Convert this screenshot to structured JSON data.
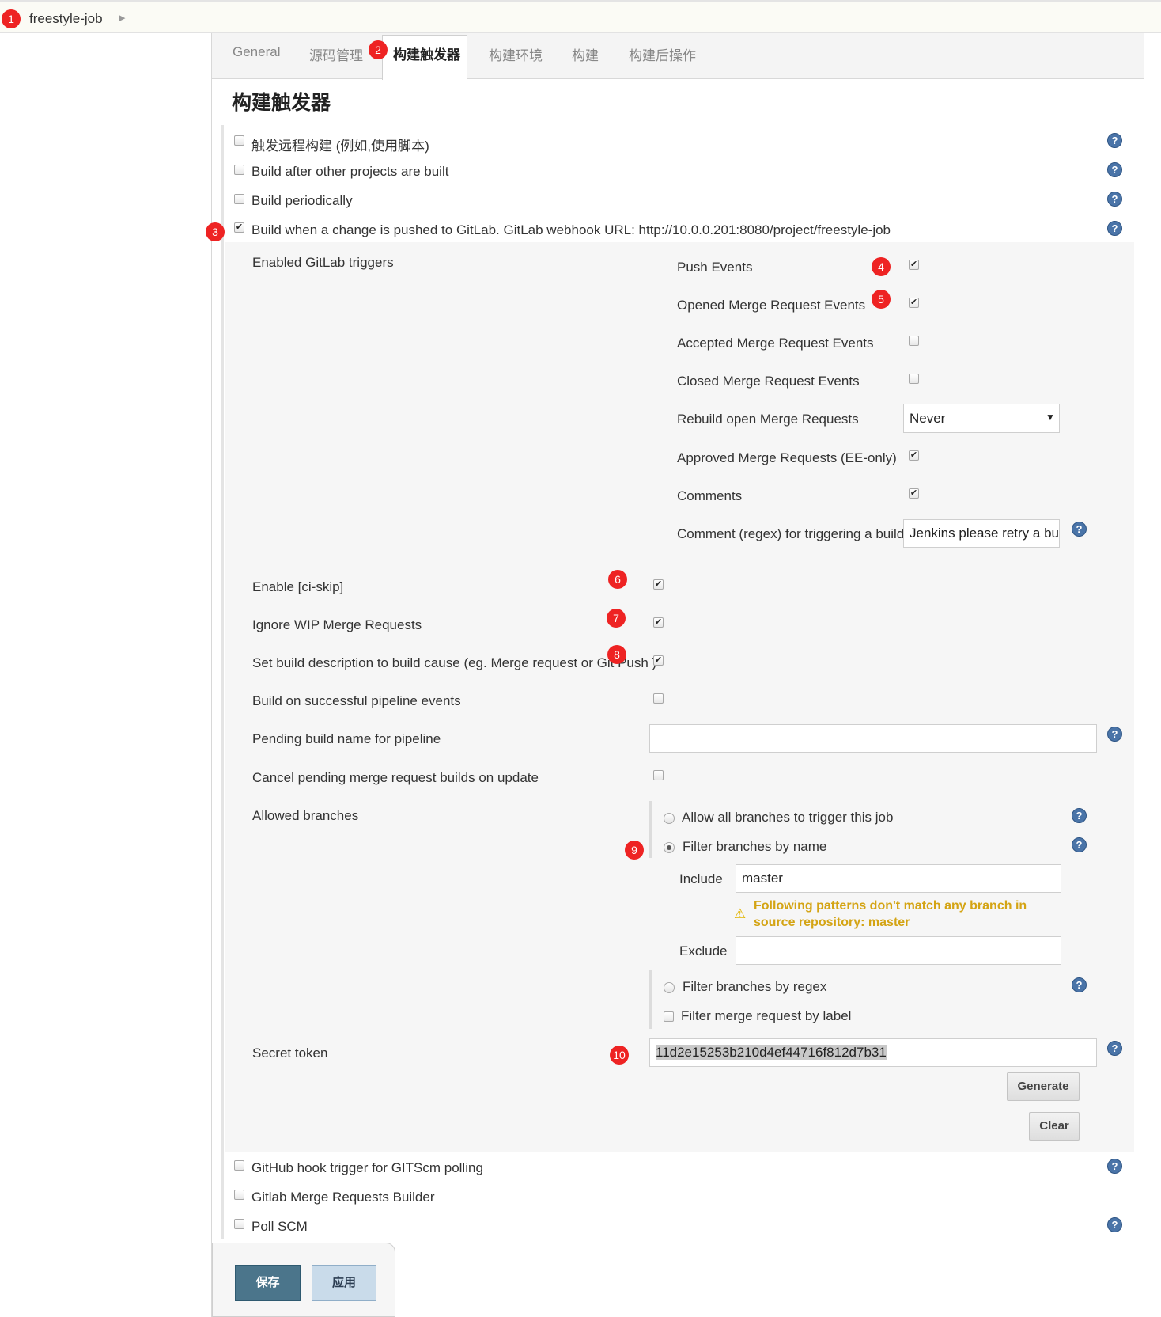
{
  "breadcrumb": {
    "project": "freestyle-job"
  },
  "tabs": [
    {
      "label": "General"
    },
    {
      "label": "源码管理"
    },
    {
      "label": "构建触发器"
    },
    {
      "label": "构建环境"
    },
    {
      "label": "构建"
    },
    {
      "label": "构建后操作"
    }
  ],
  "section": {
    "title": "构建触发器"
  },
  "triggers": {
    "remote": {
      "label": "触发远程构建 (例如,使用脚本)",
      "checked": false
    },
    "after_other": {
      "label": "Build after other projects are built",
      "checked": false
    },
    "periodically": {
      "label": "Build periodically",
      "checked": false
    },
    "gitlab": {
      "label": "Build when a change is pushed to GitLab. GitLab webhook URL: http://10.0.0.201:8080/project/freestyle-job",
      "checked": true
    },
    "github_hook": {
      "label": "GitHub hook trigger for GITScm polling",
      "checked": false
    },
    "gitlab_mr_builder": {
      "label": "Gitlab Merge Requests Builder",
      "checked": false
    },
    "poll_scm": {
      "label": "Poll SCM",
      "checked": false
    }
  },
  "gitlab": {
    "enabled_triggers_label": "Enabled GitLab triggers",
    "push_events": {
      "label": "Push Events",
      "checked": true
    },
    "opened_mr": {
      "label": "Opened Merge Request Events",
      "checked": true
    },
    "accepted_mr": {
      "label": "Accepted Merge Request Events",
      "checked": false
    },
    "closed_mr": {
      "label": "Closed Merge Request Events",
      "checked": false
    },
    "rebuild": {
      "label": "Rebuild open Merge Requests",
      "value": "Never"
    },
    "approved_mr": {
      "label": "Approved Merge Requests (EE-only)",
      "checked": true
    },
    "comments": {
      "label": "Comments",
      "checked": true
    },
    "comment_regex": {
      "label": "Comment (regex) for triggering a build",
      "value": "Jenkins please retry a bui"
    },
    "ci_skip": {
      "label": "Enable [ci-skip]",
      "checked": true
    },
    "ignore_wip": {
      "label": "Ignore WIP Merge Requests",
      "checked": true
    },
    "set_description": {
      "label": "Set build description to build cause (eg. Merge request or Git Push )",
      "checked": true
    },
    "pipeline_events": {
      "label": "Build on successful pipeline events",
      "checked": false
    },
    "pending_name": {
      "label": "Pending build name for pipeline",
      "value": ""
    },
    "cancel_pending": {
      "label": "Cancel pending merge request builds on update",
      "checked": false
    },
    "allowed_branches": {
      "label": "Allowed branches",
      "allow_all": {
        "label": "Allow all branches to trigger this job",
        "selected": false
      },
      "filter_by_name": {
        "label": "Filter branches by name",
        "selected": true
      },
      "include_label": "Include",
      "include_value": "master",
      "warning": "Following patterns don't match any branch in source repository: master",
      "warning_line1": "Following patterns don't match any branch in",
      "warning_line2": "source repository: master",
      "exclude_label": "Exclude",
      "exclude_value": "",
      "filter_by_regex": {
        "label": "Filter branches by regex",
        "selected": false
      },
      "filter_by_label": {
        "label": "Filter merge request by label",
        "checked": false
      }
    },
    "secret_token": {
      "label": "Secret token",
      "value": "11d2e15253b210d4ef44716f812d7b31",
      "generate": "Generate",
      "clear": "Clear"
    }
  },
  "footer": {
    "save": "保存",
    "apply": "应用"
  },
  "annotations": [
    "1",
    "2",
    "3",
    "4",
    "5",
    "6",
    "7",
    "8",
    "9",
    "10"
  ],
  "icons": {
    "help": "help-icon",
    "checkbox": "check-icon",
    "warning": "warning-icon",
    "dropdown": "caret-down-icon",
    "breadcrumb": "chevron-right-icon"
  },
  "colors": {
    "badge": "#ee2323",
    "help": "#4a74a8",
    "save": "#4b758b",
    "apply": "#c9dbea",
    "warning": "#d4a414"
  }
}
